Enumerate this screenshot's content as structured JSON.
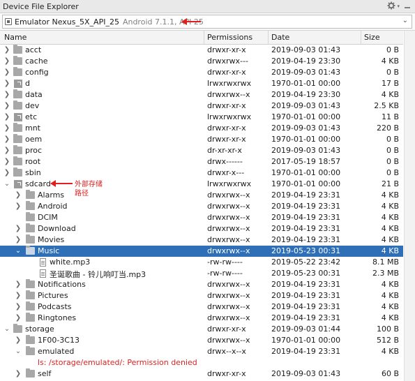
{
  "window": {
    "title": "Device File Explorer",
    "icons": [
      "gear-icon",
      "minimize-icon"
    ]
  },
  "device_selector": {
    "name": "Emulator Nexus_5X_API_25",
    "version": "Android 7.1.1, API 25"
  },
  "columns": {
    "name": "Name",
    "permissions": "Permissions",
    "date": "Date",
    "size": "Size"
  },
  "annotation": {
    "line1": "外部存储",
    "line2": "路径"
  },
  "colors": {
    "selection": "#2e6fb7",
    "annotation_red": "#e02020",
    "folder": "#a8a8a8"
  },
  "rows": [
    {
      "name": "acct",
      "perm": "drwxr-xr-x",
      "date": "2019-09-03 01:43",
      "size": "0 B"
    },
    {
      "name": "cache",
      "perm": "drwxrwx---",
      "date": "2019-04-19 23:30",
      "size": "4 KB"
    },
    {
      "name": "config",
      "perm": "drwxr-xr-x",
      "date": "2019-09-03 01:43",
      "size": "0 B"
    },
    {
      "name": "d",
      "perm": "lrwxrwxrwx",
      "date": "1970-01-01 00:00",
      "size": "17 B"
    },
    {
      "name": "data",
      "perm": "drwxrwx--x",
      "date": "2019-04-19 23:30",
      "size": "4 KB"
    },
    {
      "name": "dev",
      "perm": "drwxr-xr-x",
      "date": "2019-09-03 01:43",
      "size": "2.5 KB"
    },
    {
      "name": "etc",
      "perm": "lrwxrwxrwx",
      "date": "1970-01-01 00:00",
      "size": "11 B"
    },
    {
      "name": "mnt",
      "perm": "drwxr-xr-x",
      "date": "2019-09-03 01:43",
      "size": "220 B"
    },
    {
      "name": "oem",
      "perm": "drwxr-xr-x",
      "date": "1970-01-01 00:00",
      "size": "0 B"
    },
    {
      "name": "proc",
      "perm": "dr-xr-xr-x",
      "date": "2019-09-03 01:43",
      "size": "0 B"
    },
    {
      "name": "root",
      "perm": "drwx------",
      "date": "2017-05-19 18:57",
      "size": "0 B"
    },
    {
      "name": "sbin",
      "perm": "drwxr-x---",
      "date": "1970-01-01 00:00",
      "size": "0 B"
    },
    {
      "name": "sdcard",
      "perm": "lrwxrwxrwx",
      "date": "1970-01-01 00:00",
      "size": "21 B"
    },
    {
      "name": "Alarms",
      "perm": "drwxrwx--x",
      "date": "2019-04-19 23:31",
      "size": "4 KB"
    },
    {
      "name": "Android",
      "perm": "drwxrwx--x",
      "date": "2019-04-19 23:31",
      "size": "4 KB"
    },
    {
      "name": "DCIM",
      "perm": "drwxrwx--x",
      "date": "2019-04-19 23:31",
      "size": "4 KB"
    },
    {
      "name": "Download",
      "perm": "drwxrwx--x",
      "date": "2019-04-19 23:31",
      "size": "4 KB"
    },
    {
      "name": "Movies",
      "perm": "drwxrwx--x",
      "date": "2019-04-19 23:31",
      "size": "4 KB"
    },
    {
      "name": "Music",
      "perm": "drwxrwx--x",
      "date": "2019-05-23 00:31",
      "size": "4 KB"
    },
    {
      "name": "white.mp3",
      "perm": "-rw-rw----",
      "date": "2019-05-22 23:42",
      "size": "8.1 MB"
    },
    {
      "name": "圣诞歌曲 - 铃儿响叮当.mp3",
      "perm": "-rw-rw----",
      "date": "2019-05-23 00:31",
      "size": "2.3 MB"
    },
    {
      "name": "Notifications",
      "perm": "drwxrwx--x",
      "date": "2019-04-19 23:31",
      "size": "4 KB"
    },
    {
      "name": "Pictures",
      "perm": "drwxrwx--x",
      "date": "2019-04-19 23:31",
      "size": "4 KB"
    },
    {
      "name": "Podcasts",
      "perm": "drwxrwx--x",
      "date": "2019-04-19 23:31",
      "size": "4 KB"
    },
    {
      "name": "Ringtones",
      "perm": "drwxrwx--x",
      "date": "2019-04-19 23:31",
      "size": "4 KB"
    },
    {
      "name": "storage",
      "perm": "drwxr-xr-x",
      "date": "2019-09-03 01:44",
      "size": "100 B"
    },
    {
      "name": "1F00-3C13",
      "perm": "drwxrwx--x",
      "date": "1970-01-01 00:00",
      "size": "512 B"
    },
    {
      "name": "emulated",
      "perm": "drwx--x--x",
      "date": "2019-04-19 23:31",
      "size": "4 KB"
    },
    {
      "error": "ls: /storage/emulated/: Permission denied"
    },
    {
      "name": "self",
      "perm": "drwxr-xr-x",
      "date": "2019-09-03 01:43",
      "size": "60 B"
    }
  ]
}
